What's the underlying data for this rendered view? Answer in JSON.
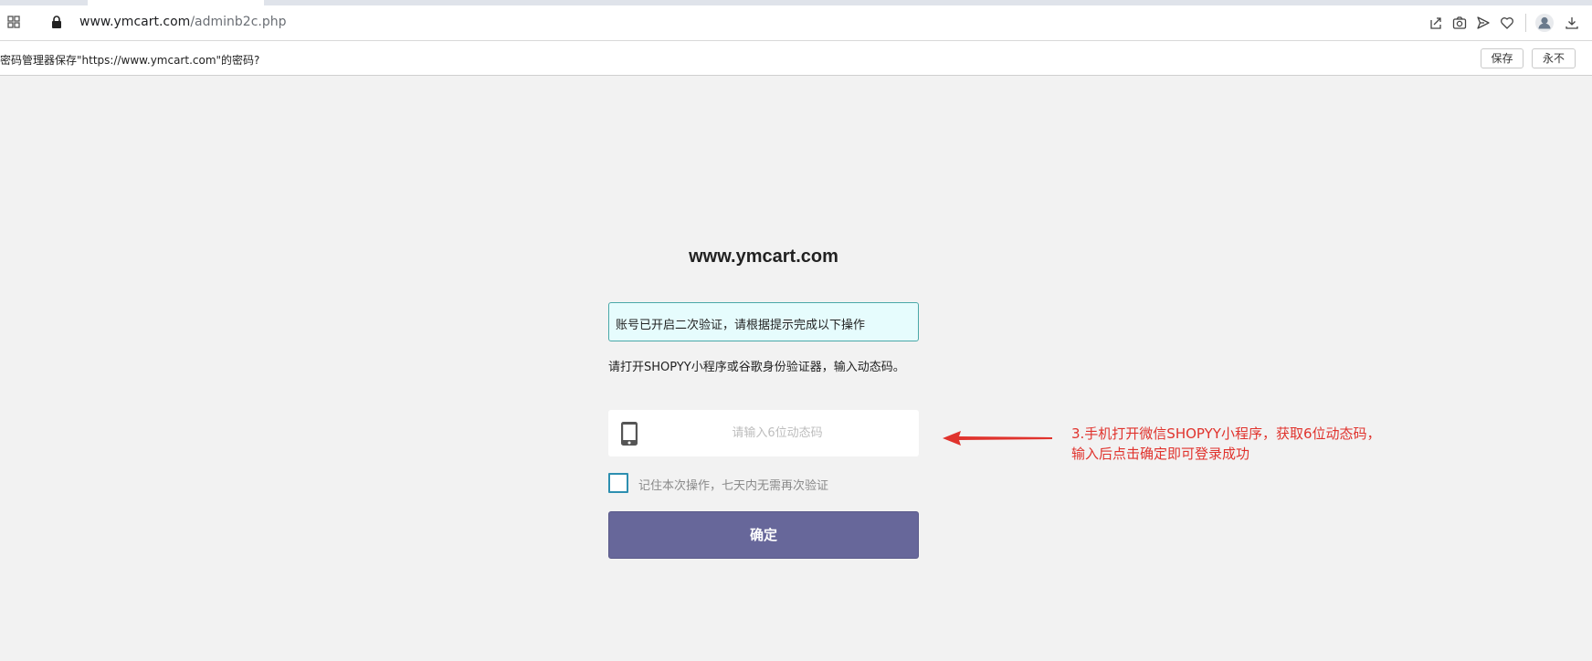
{
  "browser": {
    "url_host": "www.ymcart.com",
    "url_path": "/adminb2c.php",
    "icons": [
      "apps-icon",
      "lock-icon",
      "share-icon",
      "camera-icon",
      "send-icon",
      "heart-icon",
      "profile-icon",
      "download-icon"
    ]
  },
  "password_bar": {
    "message": "密码管理器保存\"https://www.ymcart.com\"的密码?",
    "save_label": "保存",
    "never_label": "永不"
  },
  "login": {
    "site_title": "www.ymcart.com",
    "notice": "账号已开启二次验证，请根据提示完成以下操作",
    "instruction": "请打开SHOPYY小程序或谷歌身份验证器，输入动态码。",
    "code_placeholder": "请输入6位动态码",
    "code_value": "",
    "remember_label": "记住本次操作，七天内无需再次验证",
    "remember_checked": false,
    "confirm_label": "确定",
    "colors": {
      "notice_bg": "#e6fcfd",
      "notice_border": "#4aa8a8",
      "confirm_bg": "#67679a",
      "checkbox_border": "#2d8fb0"
    }
  },
  "annotation": {
    "line1": "3.手机打开微信SHOPYY小程序，获取6位动态码，",
    "line2": "输入后点击确定即可登录成功",
    "color": "#e0332d"
  }
}
